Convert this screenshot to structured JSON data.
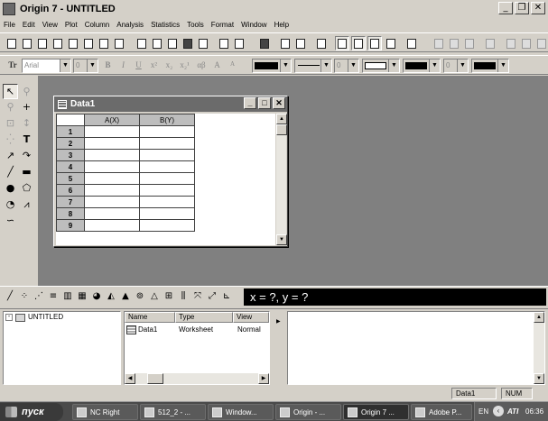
{
  "window": {
    "title": "Origin 7 - UNTITLED",
    "min": "_",
    "restore": "❐",
    "close": "✕"
  },
  "menu": [
    "File",
    "Edit",
    "View",
    "Plot",
    "Column",
    "Analysis",
    "Statistics",
    "Tools",
    "Format",
    "Window",
    "Help"
  ],
  "format_bar": {
    "font_marker": "Tr",
    "font": "Arial",
    "size": "0",
    "bold": "B",
    "italic": "I",
    "underline": "U",
    "superscript": "x²",
    "subscript": "x₂",
    "supersub": "x₂¹",
    "greek": "αβ",
    "grow": "A",
    "shrink": "A",
    "line_width": "0",
    "pattern_width": "0"
  },
  "data_window": {
    "title": "Data1",
    "columns": [
      "A(X)",
      "B(Y)"
    ],
    "rows": [
      "1",
      "2",
      "3",
      "4",
      "5",
      "6",
      "7",
      "8",
      "9"
    ]
  },
  "coordinates": "x = ?, y = ?",
  "explorer": {
    "folder": "UNTITLED",
    "headers": [
      "Name",
      "Type",
      "View"
    ],
    "items": [
      {
        "name": "Data1",
        "type": "Worksheet",
        "view": "Normal"
      }
    ]
  },
  "status": {
    "window": "Data1",
    "num": "NUM"
  },
  "taskbar": {
    "start": "пуск",
    "tasks": [
      "NC Right",
      "512_2 - ...",
      "Window...",
      "Origin - ...",
      "Origin 7 ...",
      "Adobe P..."
    ],
    "lang": "EN",
    "clock": "06:36"
  }
}
